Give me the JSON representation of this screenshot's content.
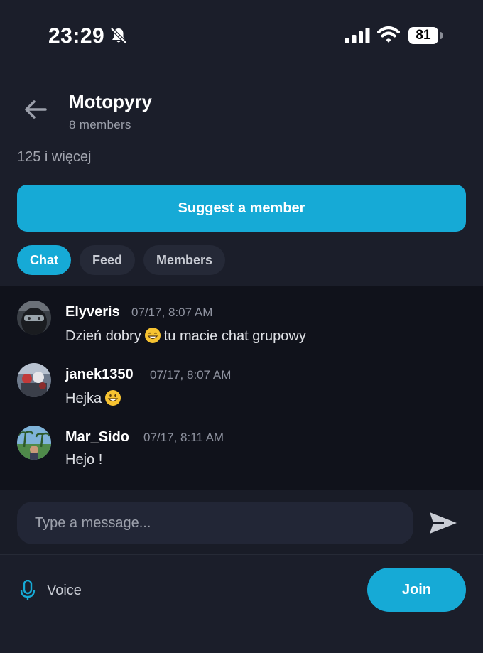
{
  "status_bar": {
    "time": "23:29",
    "battery": "81"
  },
  "header": {
    "title": "Motopyry",
    "member_count": "8 members",
    "description": "125 i więcej"
  },
  "suggest_button_label": "Suggest a member",
  "tabs": [
    {
      "label": "Chat",
      "active": true
    },
    {
      "label": "Feed",
      "active": false
    },
    {
      "label": "Members",
      "active": false
    }
  ],
  "messages": [
    {
      "author": "Elyveris",
      "time": "07/17, 8:07 AM",
      "text_before": "Dzień dobry",
      "emoji": "grinning-face-with-smiling-eyes",
      "text_after": "tu macie chat grupowy"
    },
    {
      "author": "janek1350",
      "time": "07/17, 8:07 AM",
      "text_before": "Hejka",
      "emoji": "grinning-face",
      "text_after": ""
    },
    {
      "author": "Mar_Sido",
      "time": "07/17, 8:11 AM",
      "text_before": "Hejo !",
      "emoji": "",
      "text_after": ""
    }
  ],
  "composer": {
    "placeholder": "Type a message..."
  },
  "bottom": {
    "voice_label": "Voice",
    "join_label": "Join"
  },
  "colors": {
    "accent": "#16aad6",
    "background": "#1b1e2a",
    "chat_background": "#10121b"
  }
}
